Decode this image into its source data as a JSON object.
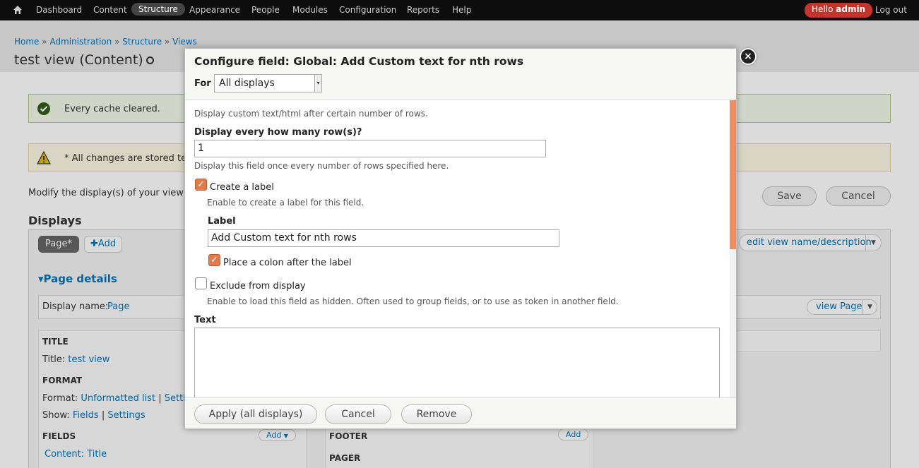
{
  "toolbar": {
    "items": [
      "Dashboard",
      "Content",
      "Structure",
      "Appearance",
      "People",
      "Modules",
      "Configuration",
      "Reports",
      "Help"
    ],
    "active": "Structure",
    "hello": "Hello",
    "user": "admin",
    "logout": "Log out"
  },
  "breadcrumb": [
    "Home",
    "Administration",
    "Structure",
    "Views"
  ],
  "breadcrumb_sep": "»",
  "page_title": "test view (Content)",
  "messages": {
    "status": "Every cache cleared.",
    "warning": "* All changes are stored te"
  },
  "modify_text": "Modify the display(s) of your view",
  "buttons": {
    "save": "Save",
    "cancel": "Cancel"
  },
  "displays": {
    "heading": "Displays",
    "tab_page": "Page*",
    "tab_add": "Add",
    "edit_view": "edit view name/description",
    "page_details": "Page details",
    "display_name_label": "Display name:",
    "display_name_value": "Page",
    "view_page": "view Page"
  },
  "sections": {
    "title_heading": "TITLE",
    "title_label": "Title:",
    "title_value": "test view",
    "format_heading": "FORMAT",
    "format_label": "Format:",
    "format_value": "Unformatted list",
    "format_sep": "|",
    "format_settings": "Setti",
    "show_label": "Show:",
    "show_value": "Fields",
    "show_sep": "|",
    "show_settings": "Settings",
    "fields_heading": "FIELDS",
    "fields_add": "Add",
    "fields_item": "Content: Title",
    "footer_heading": "FOOTER",
    "footer_add": "Add",
    "pager_heading": "PAGER"
  },
  "modal": {
    "title": "Configure field: Global: Add Custom text for nth rows",
    "for_label": "For",
    "for_value": "All displays",
    "close": "×",
    "description": "Display custom text/html after certain number of rows.",
    "rows_label": "Display every how many row(s)?",
    "rows_value": "1",
    "rows_help": "Display this field once every number of rows specified here.",
    "create_label": "Create a label",
    "create_label_help": "Enable to create a label for this field.",
    "label_heading": "Label",
    "label_value": "Add Custom text for nth rows",
    "colon_label": "Place a colon after the label",
    "exclude_label": "Exclude from display",
    "exclude_help": "Enable to load this field as hidden. Often used to group fields, or to use as token in another field.",
    "text_heading": "Text",
    "apply": "Apply (all displays)",
    "cancel": "Cancel",
    "remove": "Remove"
  }
}
